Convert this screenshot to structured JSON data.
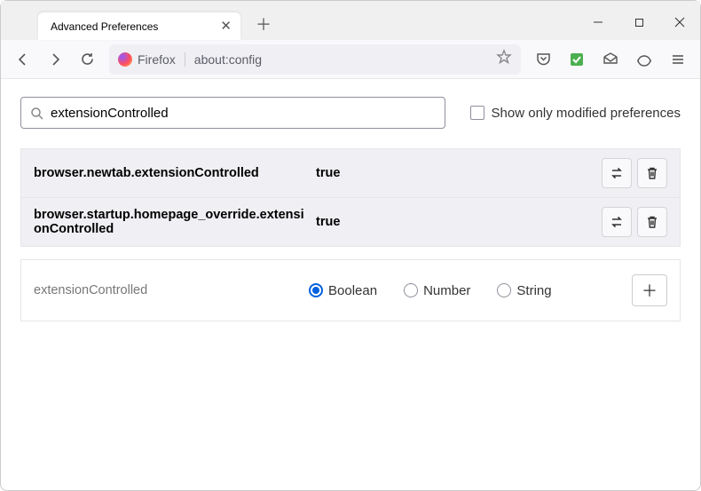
{
  "window": {
    "tab_title": "Advanced Preferences"
  },
  "toolbar": {
    "identity_label": "Firefox",
    "url": "about:config"
  },
  "search": {
    "value": "extensionControlled",
    "checkbox_label": "Show only modified preferences",
    "checkbox_checked": false
  },
  "prefs": [
    {
      "name": "browser.newtab.extensionControlled",
      "value": "true",
      "modified": true
    },
    {
      "name": "browser.startup.homepage_override.extensionControlled",
      "value": "true",
      "modified": true
    }
  ],
  "new_pref": {
    "name": "extensionControlled",
    "types": [
      "Boolean",
      "Number",
      "String"
    ],
    "selected_type": "Boolean"
  }
}
